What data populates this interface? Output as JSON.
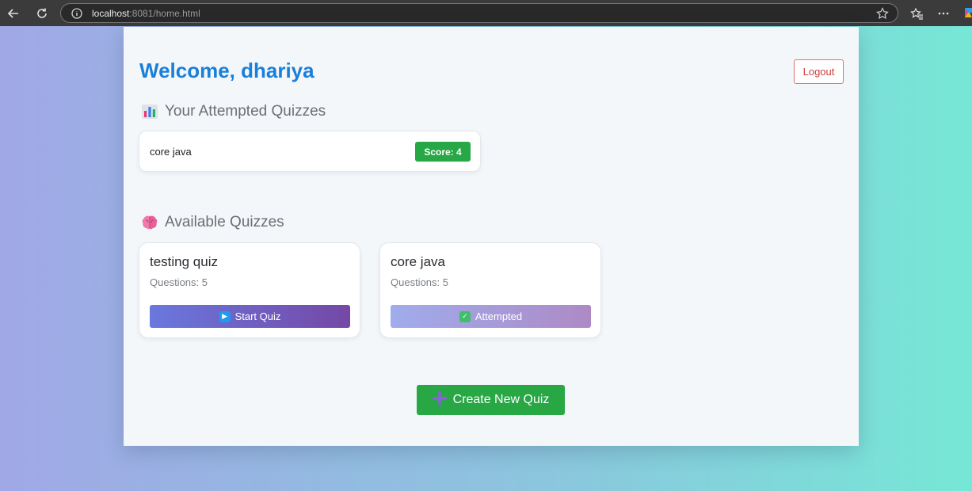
{
  "browser": {
    "url_host": "localhost",
    "url_rest": ":8081/home.html"
  },
  "header": {
    "welcome": "Welcome, dhariya",
    "logout_label": "Logout"
  },
  "attempted": {
    "title": "Your Attempted Quizzes",
    "items": [
      {
        "name": "core java",
        "score": "Score: 4"
      }
    ]
  },
  "available": {
    "title": "Available Quizzes",
    "quizzes": [
      {
        "title": "testing quiz",
        "questions": "Questions: 5",
        "button": "Start Quiz"
      },
      {
        "title": "core java",
        "questions": "Questions: 5",
        "button": "Attempted"
      }
    ]
  },
  "create_label": "Create New Quiz",
  "colors": {
    "accent_blue": "#1a7fd9",
    "success_green": "#28a745",
    "logout_red": "#cc3b3b"
  }
}
